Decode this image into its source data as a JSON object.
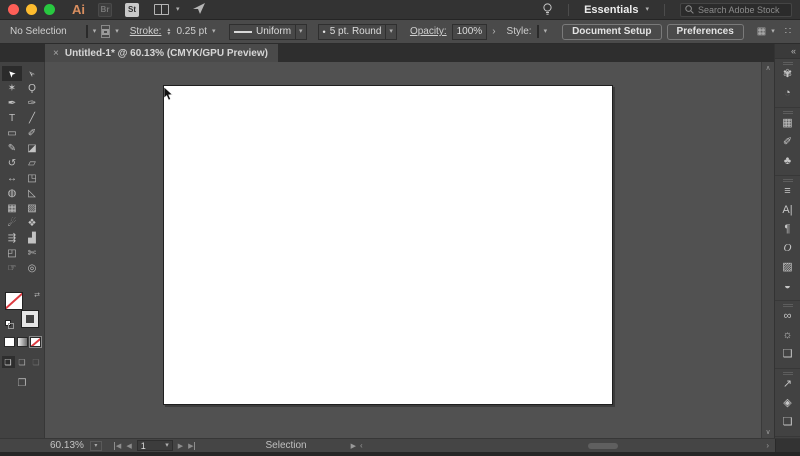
{
  "header": {
    "app_logo": "Ai",
    "bridge_label": "Br",
    "stock_label": "St",
    "workspace_name": "Essentials",
    "search_placeholder": "Search Adobe Stock"
  },
  "control_bar": {
    "selection_status": "No Selection",
    "stroke_label": "Stroke:",
    "stroke_value": "0.25 pt",
    "width_profile": "Uniform",
    "brush_definition": "5 pt. Round",
    "opacity_label": "Opacity:",
    "opacity_value": "100%",
    "style_label": "Style:",
    "document_setup_label": "Document Setup",
    "preferences_label": "Preferences"
  },
  "tab": {
    "close_glyph": "×",
    "title": "Untitled-1* @ 60.13% (CMYK/GPU Preview)"
  },
  "toolbar": {
    "tools": [
      {
        "name": "selection-tool",
        "glyph": "➤",
        "cls": "arrow",
        "active": true
      },
      {
        "name": "direct-selection-tool",
        "glyph": "➣",
        "cls": "arrow"
      },
      {
        "name": "magic-wand-tool",
        "glyph": "✶"
      },
      {
        "name": "lasso-tool",
        "glyph": "Ϙ"
      },
      {
        "name": "pen-tool",
        "glyph": "✒"
      },
      {
        "name": "curvature-tool",
        "glyph": "✑"
      },
      {
        "name": "type-tool",
        "glyph": "T"
      },
      {
        "name": "line-segment-tool",
        "glyph": "╱"
      },
      {
        "name": "rectangle-tool",
        "glyph": "▭"
      },
      {
        "name": "paintbrush-tool",
        "glyph": "✐"
      },
      {
        "name": "pencil-tool",
        "glyph": "✎"
      },
      {
        "name": "eraser-tool",
        "glyph": "◪"
      },
      {
        "name": "rotate-tool",
        "glyph": "↺"
      },
      {
        "name": "scale-tool",
        "glyph": "▱"
      },
      {
        "name": "width-tool",
        "glyph": "↔"
      },
      {
        "name": "free-transform-tool",
        "glyph": "◳"
      },
      {
        "name": "shape-builder-tool",
        "glyph": "◍"
      },
      {
        "name": "perspective-grid-tool",
        "glyph": "◺"
      },
      {
        "name": "mesh-tool",
        "glyph": "▦"
      },
      {
        "name": "gradient-tool",
        "glyph": "▨"
      },
      {
        "name": "eyedropper-tool",
        "glyph": "☄"
      },
      {
        "name": "blend-tool",
        "glyph": "❖"
      },
      {
        "name": "symbol-sprayer-tool",
        "glyph": "⇶"
      },
      {
        "name": "column-graph-tool",
        "glyph": "▟"
      },
      {
        "name": "artboard-tool",
        "glyph": "◰"
      },
      {
        "name": "slice-tool",
        "glyph": "✄"
      },
      {
        "name": "hand-tool",
        "glyph": "☞"
      },
      {
        "name": "zoom-tool",
        "glyph": "◎"
      }
    ],
    "draw_mode_glyph": "❏",
    "screen_mode_glyph": "❐"
  },
  "panel_strip": {
    "collapse_glyph": "«",
    "groups": [
      [
        {
          "name": "color-panel-icon",
          "glyph": "✾"
        },
        {
          "name": "color-guide-panel-icon",
          "glyph": "◔"
        }
      ],
      [
        {
          "name": "swatches-panel-icon",
          "glyph": "▦"
        },
        {
          "name": "brushes-panel-icon",
          "glyph": "✐"
        },
        {
          "name": "symbols-panel-icon",
          "glyph": "♣"
        }
      ],
      [
        {
          "name": "stroke-panel-icon",
          "glyph": "≡"
        },
        {
          "name": "character-panel-icon",
          "glyph": "A|"
        },
        {
          "name": "paragraph-panel-icon",
          "glyph": "¶"
        },
        {
          "name": "opentype-panel-icon",
          "glyph": "O",
          "serif": true
        },
        {
          "name": "gradient-panel-icon",
          "glyph": "▨"
        },
        {
          "name": "transparency-panel-icon",
          "glyph": "◒"
        }
      ],
      [
        {
          "name": "libraries-panel-icon",
          "glyph": "∞"
        },
        {
          "name": "appearance-panel-icon",
          "glyph": "☼"
        },
        {
          "name": "graphic-styles-panel-icon",
          "glyph": "❑"
        }
      ],
      [
        {
          "name": "asset-export-panel-icon",
          "glyph": "↗"
        },
        {
          "name": "layers-panel-icon",
          "glyph": "◈"
        },
        {
          "name": "artboards-panel-icon",
          "glyph": "❏"
        }
      ]
    ]
  },
  "status_bar": {
    "zoom_value": "60.13%",
    "artboard_nav_value": "1",
    "status_text": "Selection"
  },
  "icons": {
    "chevron_down": "▾",
    "stepper_up": "▴",
    "stepper_down": "▾",
    "submenu_right": "›",
    "menu": "≡",
    "dots": "∷",
    "arrange": "◫",
    "snap_grid": "▦",
    "swap": "⇄",
    "dot": "•",
    "tri_left": "◀",
    "tri_right": "▶",
    "flyout_left": "‹",
    "scroll_up": "∧",
    "scroll_down": "∨",
    "scroll_right": "›"
  },
  "colors": {
    "mac_close": "#ff5f57",
    "mac_minimize": "#febc2e",
    "mac_zoom": "#28c840",
    "none_slash_red": "#dd3b41",
    "artboard": "#ffffff",
    "ui_dark": "#333333",
    "ui_mid": "#4a4a4a",
    "pasteboard": "#515151"
  }
}
